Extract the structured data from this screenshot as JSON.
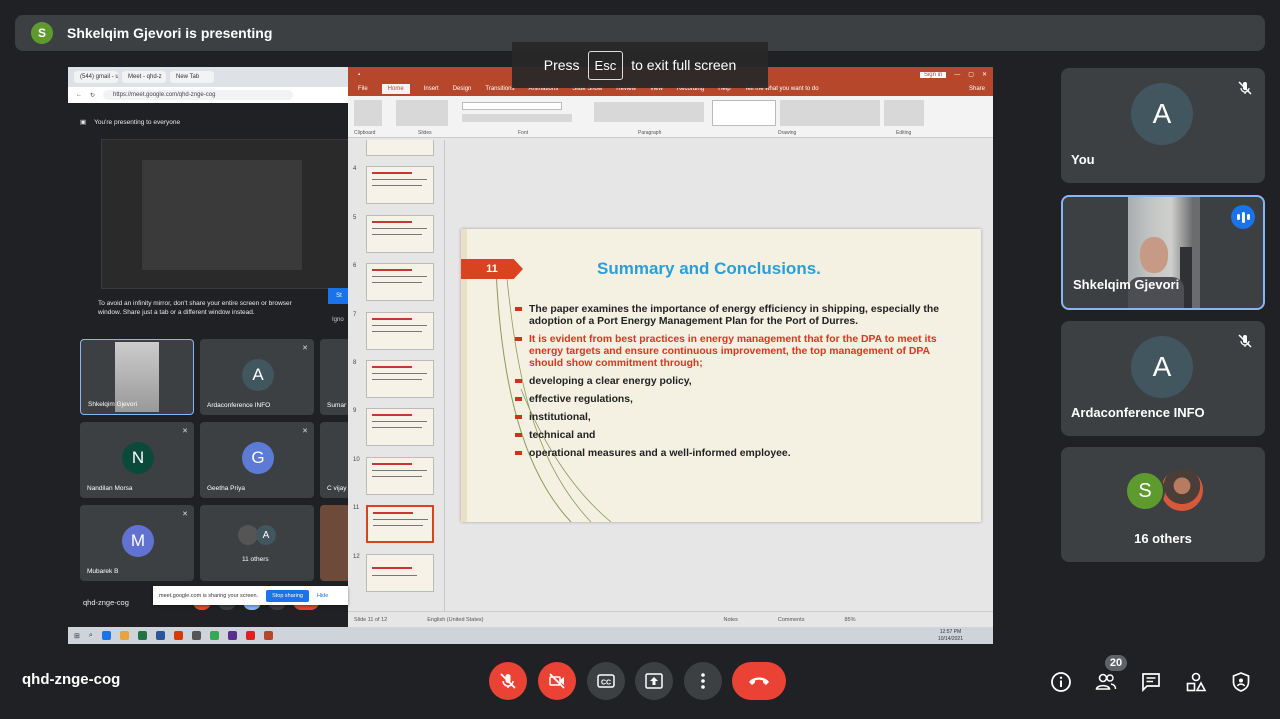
{
  "presenter_banner": {
    "initial": "S",
    "text": "Shkelqim Gjevori is presenting"
  },
  "escape_hint": {
    "press": "Press",
    "key": "Esc",
    "action": "to exit full screen"
  },
  "shared_screen": {
    "browser": {
      "tabs": [
        "(544) gmail - ustw",
        "Meet - qhd-z",
        "New Tab"
      ],
      "url": "https://meet.google.com/qhd-znge-cog",
      "presenting_notice": "You're presenting to everyone",
      "mirror_warning": "To avoid an infinity mirror, don't share your entire screen or browser window. Share just a tab or a different window instead.",
      "stop_label": "St",
      "ignore_label": "Igno",
      "participants": [
        {
          "name": "Shkelqim Gjevori",
          "initial": ""
        },
        {
          "name": "Ardaconference INFO",
          "initial": "A",
          "color": "#41565e"
        },
        {
          "name": "Sumar",
          "initial": ""
        },
        {
          "name": "Nandilan Morsa",
          "initial": "N",
          "color": "#0b4a3a"
        },
        {
          "name": "Geetha Priya",
          "initial": "G",
          "color": "#5b7bd5"
        },
        {
          "name": "C vijay",
          "initial": ""
        },
        {
          "name": "Mubarek B",
          "initial": "M",
          "color": "#6272d1"
        },
        {
          "name": "11 others",
          "initial": "A"
        }
      ],
      "meeting_code": "qhd-znge-cog"
    },
    "powerpoint": {
      "tabs": [
        "File",
        "Home",
        "Insert",
        "Design",
        "Transitions",
        "Animations",
        "Slide Show",
        "Review",
        "View",
        "Recording",
        "Help",
        "Tell me what you want to do"
      ],
      "active_tab": "Home",
      "sign_in": "Sign in",
      "share": "Share",
      "ribbon_groups": [
        "Clipboard",
        "Slides",
        "Font",
        "Paragraph",
        "Drawing",
        "Editing"
      ],
      "slide_numbers": [
        "4",
        "5",
        "6",
        "7",
        "8",
        "9",
        "10",
        "11",
        "12"
      ],
      "slide": {
        "number": "11",
        "title": "Summary and Conclusions.",
        "bullets": [
          {
            "text": "The paper examines the importance of energy efficiency in shipping, especially the adoption of a Port Energy Management Plan for the Port of Durres.",
            "style": "normal"
          },
          {
            "text": "It is evident from best practices in energy management that for the DPA to meet its energy targets and ensure continuous improvement, the top management of DPA should show commitment through;",
            "style": "red"
          },
          {
            "text": "developing a clear energy policy,",
            "style": "normal"
          },
          {
            "text": "effective regulations,",
            "style": "normal"
          },
          {
            "text": "institutional,",
            "style": "normal"
          },
          {
            "text": "technical and",
            "style": "normal"
          },
          {
            "text": "operational measures and a well-informed employee.",
            "style": "normal"
          }
        ]
      },
      "status": {
        "slide_of": "Slide 11 of 12",
        "language": "English (United States)",
        "notes": "Notes",
        "comments": "Comments",
        "zoom": "85%"
      },
      "sharing_bar": {
        "text": "meet.google.com is sharing your screen.",
        "stop": "Stop sharing",
        "hide": "Hide"
      }
    },
    "taskbar": {
      "time": "12:57 PM",
      "date": "10/14/2021"
    }
  },
  "tiles": [
    {
      "name": "You",
      "initial": "A",
      "muted": true
    },
    {
      "name": "Shkelqim Gjevori",
      "speaking": true
    },
    {
      "name": "Ardaconference INFO",
      "initial": "A",
      "muted": true
    },
    {
      "name": "16 others",
      "initial": "S"
    }
  ],
  "bottom_bar": {
    "meeting_code": "qhd-znge-cog",
    "participant_count": "20",
    "colors": {
      "danger": "#ea4335",
      "button": "#3c4043",
      "accent": "#1a73e8"
    }
  }
}
